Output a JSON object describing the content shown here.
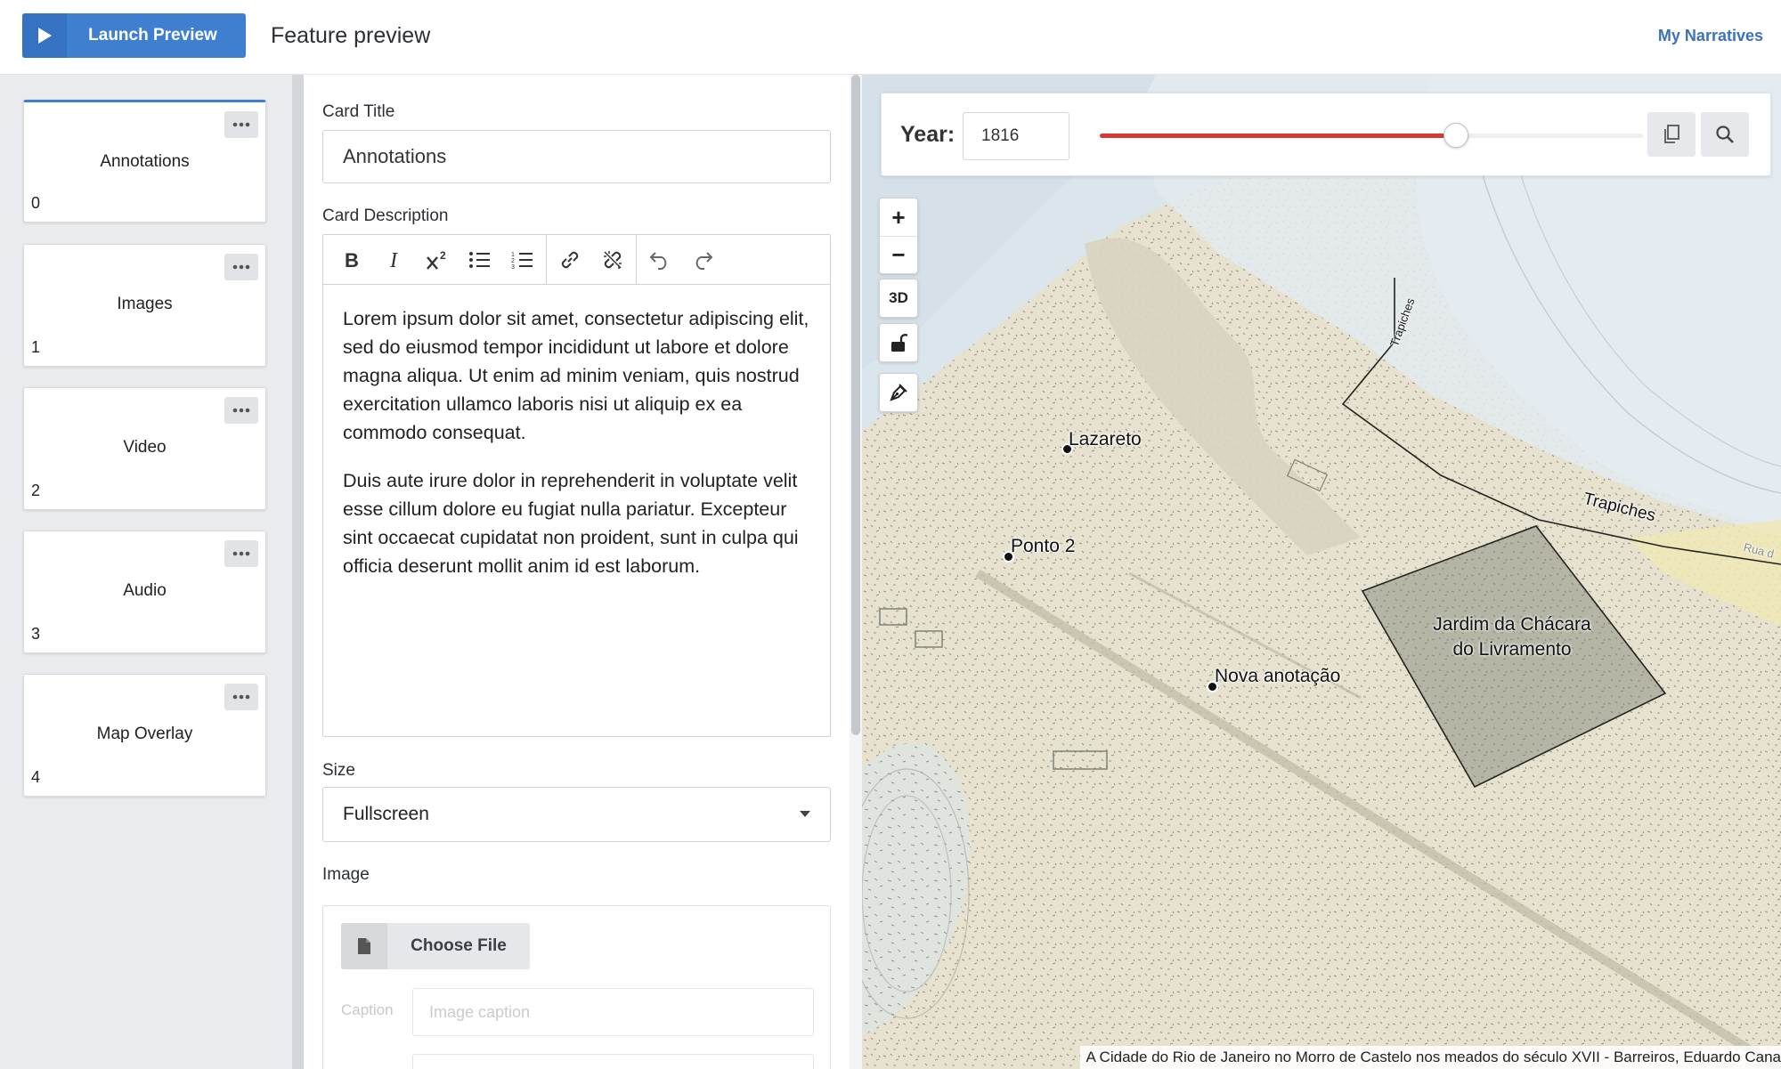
{
  "header": {
    "launch_label": "Launch Preview",
    "title": "Feature preview",
    "my_narratives": "My Narratives"
  },
  "sidebar": {
    "cards": [
      {
        "name": "Annotations",
        "index": "0",
        "active": true
      },
      {
        "name": "Images",
        "index": "1"
      },
      {
        "name": "Video",
        "index": "2"
      },
      {
        "name": "Audio",
        "index": "3"
      },
      {
        "name": "Map Overlay",
        "index": "4"
      }
    ]
  },
  "form": {
    "card_title_label": "Card Title",
    "card_title_value": "Annotations",
    "card_description_label": "Card Description",
    "description_paragraphs": [
      "Lorem ipsum dolor sit amet, consectetur adipiscing elit, sed do eiusmod tempor incididunt ut labore et dolore magna aliqua. Ut enim ad minim veniam, quis nostrud exercitation ullamco laboris nisi ut aliquip ex ea commodo consequat.",
      "Duis aute irure dolor in reprehenderit in voluptate velit esse cillum dolore eu fugiat nulla pariatur. Excepteur sint occaecat cupidatat non proident, sunt in culpa qui officia deserunt mollit anim id est laborum."
    ],
    "size_label": "Size",
    "size_value": "Fullscreen",
    "image_label": "Image",
    "choose_file_label": "Choose File",
    "caption_label": "Caption",
    "caption_placeholder": "Image caption"
  },
  "map": {
    "year_label": "Year:",
    "year_value": "1816",
    "slider_fraction": 0.655,
    "zoom_in": "+",
    "zoom_out": "−",
    "three_d": "3D",
    "labels": {
      "lazareto": "Lazareto",
      "ponto2": "Ponto 2",
      "nova": "Nova anotação",
      "trapiches": "Trapiches",
      "trapiches_small": "Trapiches",
      "rua": "Rua d",
      "polygon_line1": "Jardim da Chácara",
      "polygon_line2": "do Livramento"
    },
    "attribution": "A Cidade do Rio de Janeiro no Morro de Castelo nos meados do século XVII - Barreiros, Eduardo Cana"
  },
  "colors": {
    "accent": "#3f7fd0",
    "slider_fill": "#d53b35",
    "link": "#3b73b8"
  }
}
